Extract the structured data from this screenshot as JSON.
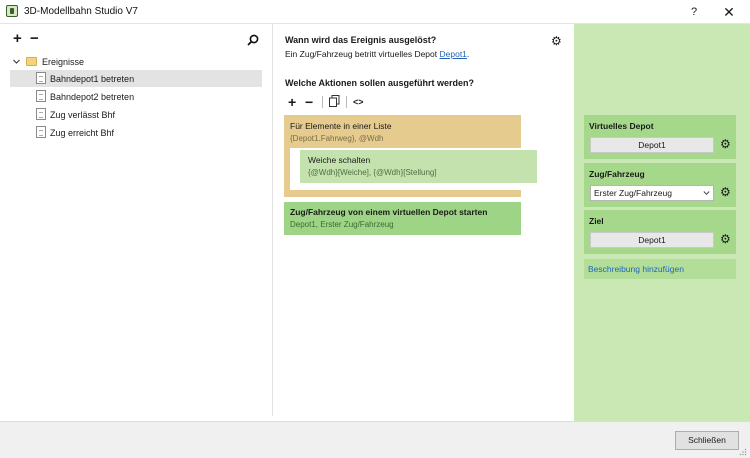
{
  "window": {
    "title": "3D-Modellbahn Studio V7",
    "help_label": "?",
    "close_label": "✕"
  },
  "left": {
    "add_label": "+",
    "remove_label": "−",
    "tree": {
      "root_label": "Ereignisse",
      "items": [
        {
          "label": "Bahndepot1 betreten",
          "selected": true
        },
        {
          "label": "Bahndepot2 betreten",
          "selected": false
        },
        {
          "label": "Zug verlässt Bhf",
          "selected": false
        },
        {
          "label": "Zug erreicht Bhf",
          "selected": false
        }
      ]
    }
  },
  "middle": {
    "trigger_question": "Wann wird das Ereignis ausgelöst?",
    "trigger_desc_prefix": "Ein Zug/Fahrzeug betritt virtuelles Depot ",
    "trigger_desc_link": "Depot1",
    "trigger_desc_suffix": ".",
    "actions_question": "Welche Aktionen sollen ausgeführt werden?",
    "toolbar": {
      "add": "+",
      "remove": "−",
      "code": "<>"
    },
    "actions": {
      "loop": {
        "title": "Für Elemente in einer Liste",
        "sub": "{Depot1.Fahrweg}, @Wdh"
      },
      "switch": {
        "title": "Weiche schalten",
        "sub": "{@Wdh}[Weiche], {@Wdh}[Stellung]"
      },
      "depot": {
        "title": "Zug/Fahrzeug von einem virtuellen Depot starten",
        "sub": "Depot1, Erster Zug/Fahrzeug"
      }
    }
  },
  "right": {
    "virtual_depot": {
      "title": "Virtuelles Depot",
      "value": "Depot1"
    },
    "vehicle": {
      "title": "Zug/Fahrzeug",
      "value": "Erster Zug/Fahrzeug"
    },
    "target": {
      "title": "Ziel",
      "value": "Depot1"
    },
    "add_description": "Beschreibung hinzufügen"
  },
  "footer": {
    "close_button": "Schließen"
  },
  "colors": {
    "loop_block": "#e5cb8e",
    "switch_block": "#c4e2ae",
    "depot_block": "#9ed485",
    "right_panel": "#c9e8b3",
    "link": "#1f64b8"
  }
}
